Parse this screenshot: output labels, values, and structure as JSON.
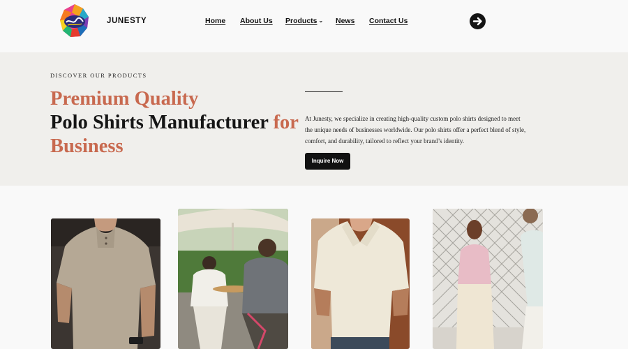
{
  "header": {
    "brand": "JUNESTY",
    "logo_icon": "junesty-logo",
    "nav": [
      {
        "label": "Home"
      },
      {
        "label": "About Us"
      },
      {
        "label": "Products",
        "has_dropdown": true
      },
      {
        "label": "News"
      },
      {
        "label": "Contact Us"
      }
    ],
    "action_icon": "arrow-right-circle-icon"
  },
  "hero": {
    "eyebrow": "DISCOVER OUR PRODUCTS",
    "headline_line1": "Premium Quality",
    "headline_line2_main": "Polo Shirts Manufacturer ",
    "headline_line2_accent": "for",
    "headline_line3": "Business",
    "description": "At Junesty, we specialize in creating high-quality custom polo shirts designed to meet the unique needs of businesses worldwide. Our polo shirts offer a perfect blend of style, comfort, and durability, tailored to reflect your brand’s identity.",
    "cta_label": "Inquire Now"
  },
  "products": [
    {
      "subject": "man in beige henley polo shirt"
    },
    {
      "subject": "two men in polo shirts at outdoor cafe"
    },
    {
      "subject": "man in cream knit polo shirt"
    },
    {
      "subject": "woman in pink polo shirt and man in light polo"
    }
  ],
  "colors": {
    "accent": "#c8694f",
    "hero_bg": "#f0efec",
    "page_bg": "#f9f9f9",
    "button_bg": "#111111"
  }
}
